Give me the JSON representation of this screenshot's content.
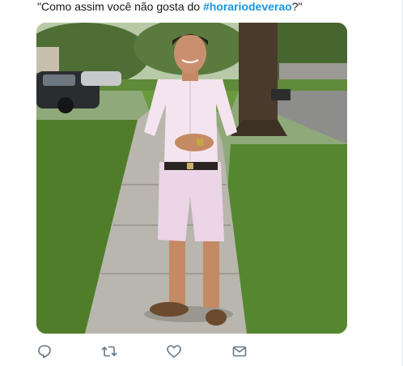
{
  "tweet": {
    "text_prefix": "\"Como assim você não gosta do ",
    "hashtag": "#horariodeverao",
    "text_suffix": "?\""
  },
  "actions": [
    {
      "name": "reply",
      "icon": "reply-icon"
    },
    {
      "name": "retweet",
      "icon": "retweet-icon"
    },
    {
      "name": "like",
      "icon": "heart-icon"
    },
    {
      "name": "direct-message",
      "icon": "envelope-icon"
    }
  ],
  "colors": {
    "hashtag": "#1b95e0",
    "text": "#14171a",
    "icon": "#657786"
  }
}
